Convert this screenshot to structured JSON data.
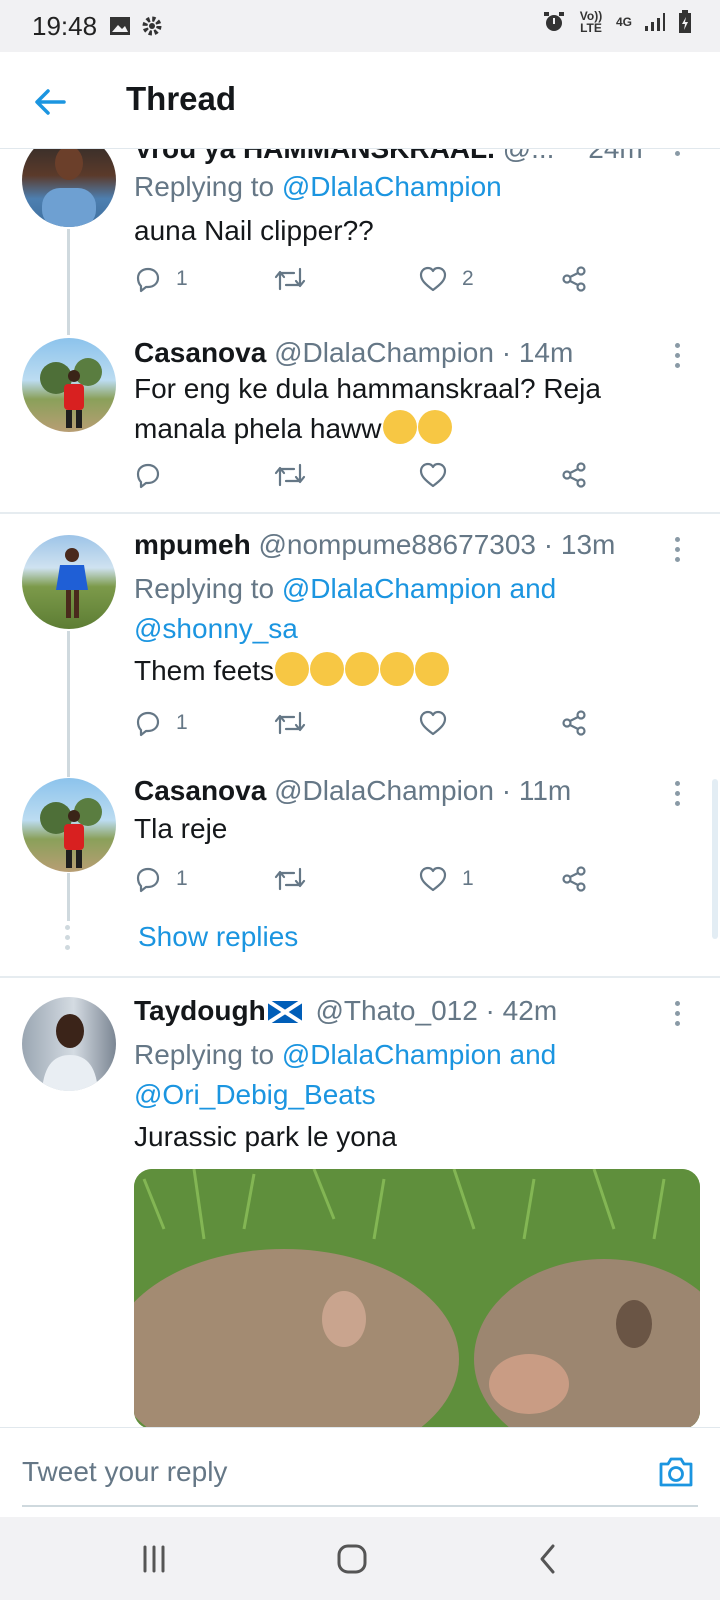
{
  "status_bar": {
    "time": "19:48",
    "volte": "Vo)) LTE",
    "network": "4G"
  },
  "app_bar": {
    "title": "Thread"
  },
  "tweets": [
    {
      "name": "Vrou ya HAMMANSKRAAL.",
      "handle": "@...",
      "time": "24m",
      "replying_prefix": "Replying to ",
      "replying_to": "@DlalaChampion",
      "text": "auna Nail clipper??",
      "replies": "1",
      "retweets": "",
      "likes": "2"
    },
    {
      "name": "Casanova",
      "handle": "@DlalaChampion",
      "time": "14m",
      "text_line1": "For eng ke dula hammanskraal? Reja",
      "text_line2": "manala phela haww",
      "replies": "",
      "retweets": "",
      "likes": ""
    },
    {
      "name": "mpumeh",
      "handle": "@nompume88677303",
      "time": "13m",
      "replying_prefix": "Replying to ",
      "replying_to_line1": "@DlalaChampion and",
      "replying_to_line2": "@shonny_sa",
      "text": "Them feets",
      "replies": "1",
      "retweets": "",
      "likes": ""
    },
    {
      "name": "Casanova",
      "handle": "@DlalaChampion",
      "time": "11m",
      "text": "Tla reje",
      "replies": "1",
      "retweets": "",
      "likes": "1"
    },
    {
      "name": "Taydough",
      "handle": "@Thato_012",
      "time": "42m",
      "replying_prefix": "Replying to ",
      "replying_to_line1": "@DlalaChampion and",
      "replying_to_line2": "@Ori_Debig_Beats",
      "text": "Jurassic park le yona"
    }
  ],
  "show_replies": "Show replies",
  "composer": {
    "placeholder": "Tweet your reply"
  },
  "colors": {
    "accent": "#1b95e0",
    "secondary_text": "#657786",
    "divider": "#e6ecf0"
  }
}
